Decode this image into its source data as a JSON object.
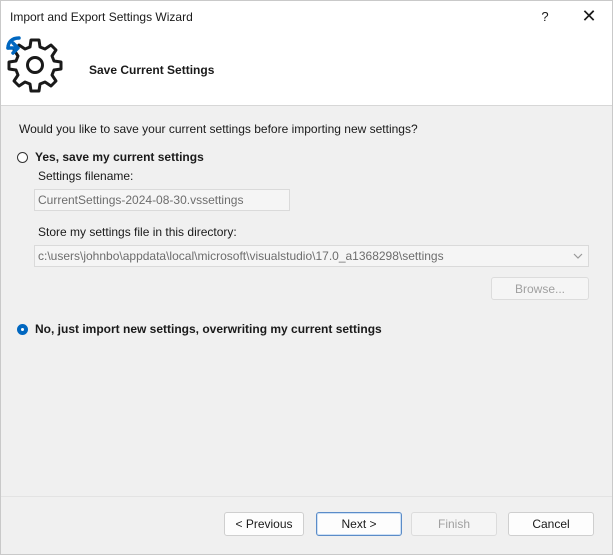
{
  "window": {
    "title": "Import and Export Settings Wizard",
    "help_glyph": "?",
    "close_glyph": "✕"
  },
  "header": {
    "title": "Save Current Settings",
    "icon": "gear-with-arrow-icon"
  },
  "main": {
    "question": "Would you like to save your current settings before importing new settings?",
    "option_yes": {
      "label": "Yes, save my current settings",
      "selected": false
    },
    "filename_label": "Settings filename:",
    "filename_value": "CurrentSettings-2024-08-30.vssettings",
    "directory_label": "Store my settings file in this directory:",
    "directory_value": "c:\\users\\johnbo\\appdata\\local\\microsoft\\visualstudio\\17.0_a1368298\\settings",
    "browse_label": "Browse...",
    "option_no": {
      "label": "No, just import new settings, overwriting my current settings",
      "selected": true
    }
  },
  "footer": {
    "previous_label": "< Previous",
    "next_label": "Next >",
    "finish_label": "Finish",
    "cancel_label": "Cancel"
  },
  "colors": {
    "accent": "#0067c0",
    "header_bg": "#ffffff",
    "body_bg": "#f0f0f0"
  }
}
